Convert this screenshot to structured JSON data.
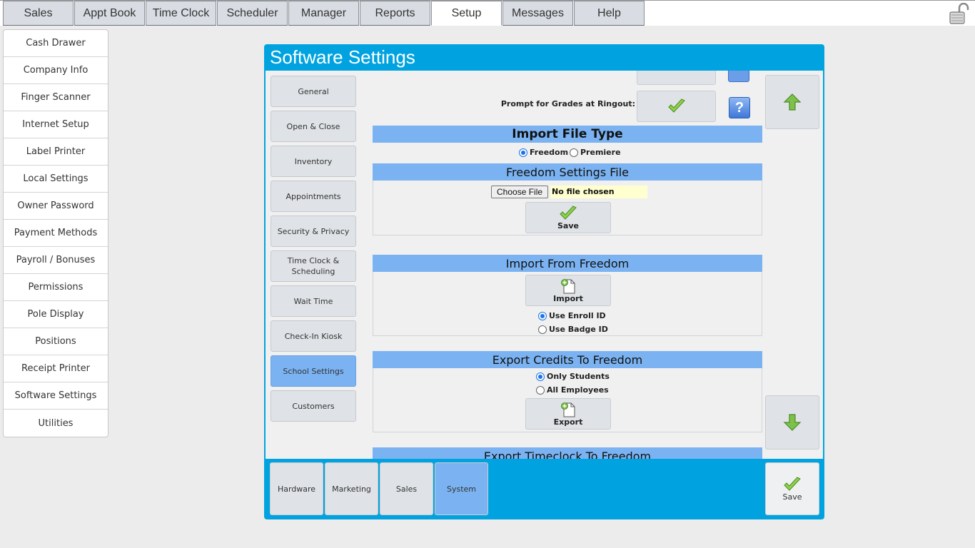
{
  "top_tabs": [
    "Sales",
    "Appt Book",
    "Time Clock",
    "Scheduler",
    "Manager",
    "Reports",
    "Setup",
    "Messages",
    "Help"
  ],
  "active_top_tab": "Setup",
  "sidebar": {
    "items": [
      "Cash Drawer",
      "Company Info",
      "Finger Scanner",
      "Internet Setup",
      "Label Printer",
      "Local Settings",
      "Owner Password",
      "Payment Methods",
      "Payroll / Bonuses",
      "Permissions",
      "Pole Display",
      "Positions",
      "Receipt Printer",
      "Software Settings",
      "Utilities"
    ]
  },
  "dialog": {
    "title": "Software Settings",
    "categories": [
      "General",
      "Open & Close",
      "Inventory",
      "Appointments",
      "Security & Privacy",
      "Time Clock & Scheduling",
      "Wait Time",
      "Check-In Kiosk",
      "School Settings",
      "Customers"
    ],
    "active_category": "School Settings",
    "prompt_grades_label": "Prompt for Grades at Ringout:",
    "import_type": {
      "heading": "Import File Type",
      "options": [
        "Freedom",
        "Premiere"
      ],
      "selected": "Freedom"
    },
    "freedom_file": {
      "heading": "Freedom Settings File",
      "choose_file_label": "Choose File",
      "file_status": "No file chosen",
      "save_label": "Save"
    },
    "import_freedom": {
      "heading": "Import From Freedom",
      "button_label": "Import",
      "options": [
        "Use Enroll ID",
        "Use Badge ID"
      ],
      "selected": "Use Enroll ID"
    },
    "export_credits": {
      "heading": "Export Credits To Freedom",
      "options": [
        "Only Students",
        "All Employees"
      ],
      "selected": "Only Students",
      "button_label": "Export"
    },
    "export_timeclock": {
      "heading": "Export Timeclock To Freedom"
    },
    "bottom_tabs": [
      "Hardware",
      "Marketing",
      "Sales",
      "System"
    ],
    "active_bottom_tab": "System",
    "save_label": "Save"
  },
  "colors": {
    "dialog_blue": "#00a3e0",
    "section_blue": "#7bb3f2",
    "check_green": "#6abf2e"
  }
}
